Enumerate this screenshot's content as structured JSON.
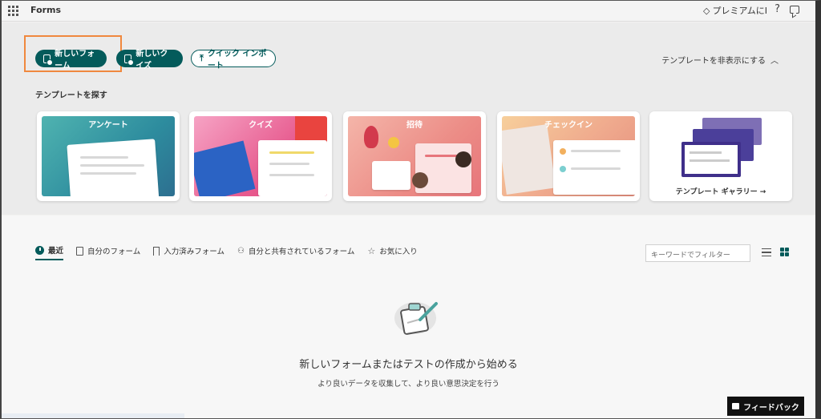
{
  "header": {
    "app_title": "Forms",
    "premium": "プレミアムにI",
    "help": "?"
  },
  "actions": {
    "new_form": "新しいフォーム",
    "new_quiz": "新しいクイズ",
    "quick_import": "クイック インポート",
    "hide_templates": "テンプレートを非表示にする"
  },
  "templates": {
    "section_title": "テンプレートを探す",
    "cards": [
      {
        "label": "アンケート"
      },
      {
        "label": "クイズ"
      },
      {
        "label": "招待"
      },
      {
        "label": "チェックイン"
      },
      {
        "label": "テンプレート ギャラリー →"
      }
    ]
  },
  "tabs": [
    {
      "label": "最近",
      "active": true
    },
    {
      "label": "自分のフォーム"
    },
    {
      "label": "入力済みフォーム"
    },
    {
      "label": "自分と共有されているフォーム"
    },
    {
      "label": "お気に入り"
    }
  ],
  "filter": {
    "placeholder": "キーワードでフィルター"
  },
  "empty_state": {
    "title": "新しいフォームまたはテストの作成から始める",
    "subtitle": "より良いデータを収集して、より良い意思決定を行う"
  },
  "feedback": {
    "label": "フィードバック"
  },
  "colors": {
    "accent": "#045b5b",
    "highlight": "#f0883e"
  }
}
